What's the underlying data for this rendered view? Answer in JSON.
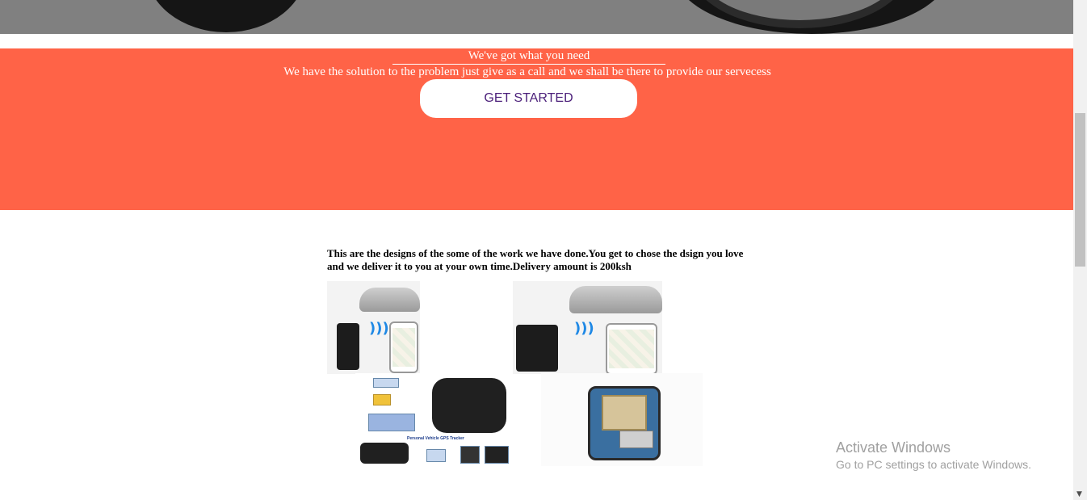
{
  "cta": {
    "heading": "We've got what you need",
    "subtext": "We have the solution to the problem just give as a call and we shall be there to provide our servecess",
    "button_label": "GET STARTED"
  },
  "work": {
    "description": "This are the designs of the some of the work we have done.You get to chose the dsign you love and we deliver it to you at your own time.Delivery amount is 200ksh",
    "products": [
      {
        "name": "gps-tracker-with-phone"
      },
      {
        "name": "gps-tracker-with-phone-large"
      },
      {
        "name": "personal-vehicle-gps-tracker",
        "caption": "Personal Vehicle GPS Tracker"
      },
      {
        "name": "gps-module-board"
      }
    ]
  },
  "overlay": {
    "activate_title": "Activate Windows",
    "activate_sub": "Go to PC settings to activate Windows."
  },
  "colors": {
    "cta_background": "#ff6347",
    "button_text": "#4b1f7a"
  },
  "icons": {
    "scroll_down": "▼"
  }
}
